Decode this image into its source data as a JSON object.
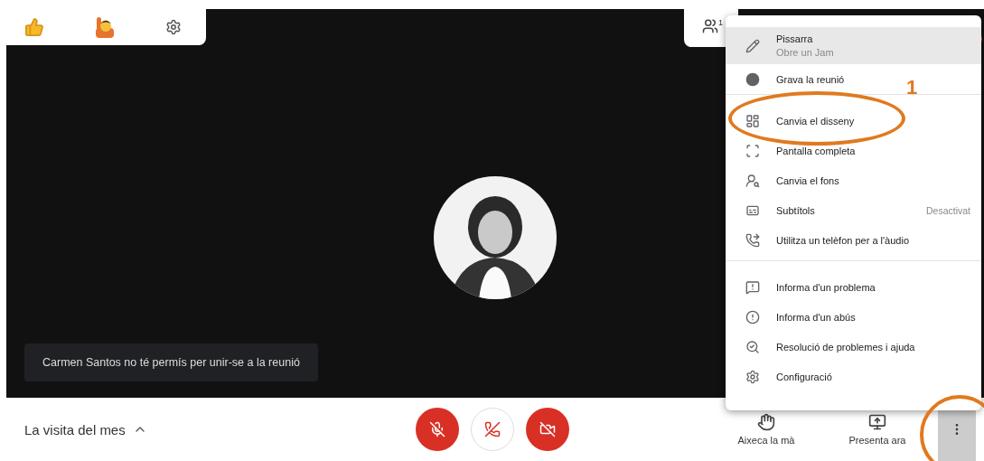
{
  "reactions_bar": {
    "items": [
      {
        "kind": "thumbs-up"
      },
      {
        "kind": "raised-hand"
      },
      {
        "kind": "settings"
      }
    ]
  },
  "participants": {
    "count": "1"
  },
  "notification": {
    "text": "Carmen Santos no té permís per unir-se a la reunió"
  },
  "menu": {
    "groups": [
      {
        "items": [
          {
            "kind": "pencil",
            "label": "Pissarra",
            "subtitle": "Obre un Jam",
            "selected": true
          },
          {
            "kind": "record",
            "label": "Grava la reunió",
            "selected": false
          }
        ]
      },
      {
        "items": [
          {
            "kind": "layout",
            "label": "Canvia el disseny",
            "selected": false
          },
          {
            "kind": "fullscreen",
            "label": "Pantalla completa",
            "selected": false
          },
          {
            "kind": "background",
            "label": "Canvia el fons",
            "selected": false
          },
          {
            "kind": "captions",
            "label": "Subtítols",
            "value": "Desactivat",
            "selected": false
          },
          {
            "kind": "phone",
            "label": "Utilitza un telèfon per a l'àudio",
            "selected": false
          }
        ]
      },
      {
        "items": [
          {
            "kind": "report",
            "label": "Informa d'un problema",
            "selected": false
          },
          {
            "kind": "abuse",
            "label": "Informa d'un abús",
            "selected": false
          },
          {
            "kind": "troubleshoot",
            "label": "Resolució de problemes i ajuda",
            "selected": false
          },
          {
            "kind": "settings",
            "label": "Configuració",
            "selected": false
          }
        ]
      }
    ]
  },
  "annotations": [
    {
      "kind": "ellipse-label",
      "label": "1"
    },
    {
      "kind": "ring"
    }
  ],
  "bottom_bar": {
    "meeting_title": "La visita del mes",
    "controls": [
      {
        "kind": "mic",
        "on": false
      },
      {
        "kind": "hangup"
      },
      {
        "kind": "camera",
        "on": false
      }
    ],
    "actions": [
      {
        "kind": "hand",
        "label": "Aixeca la mà"
      },
      {
        "kind": "present",
        "label": "Presenta ara"
      }
    ],
    "more": {
      "selected": true
    }
  }
}
